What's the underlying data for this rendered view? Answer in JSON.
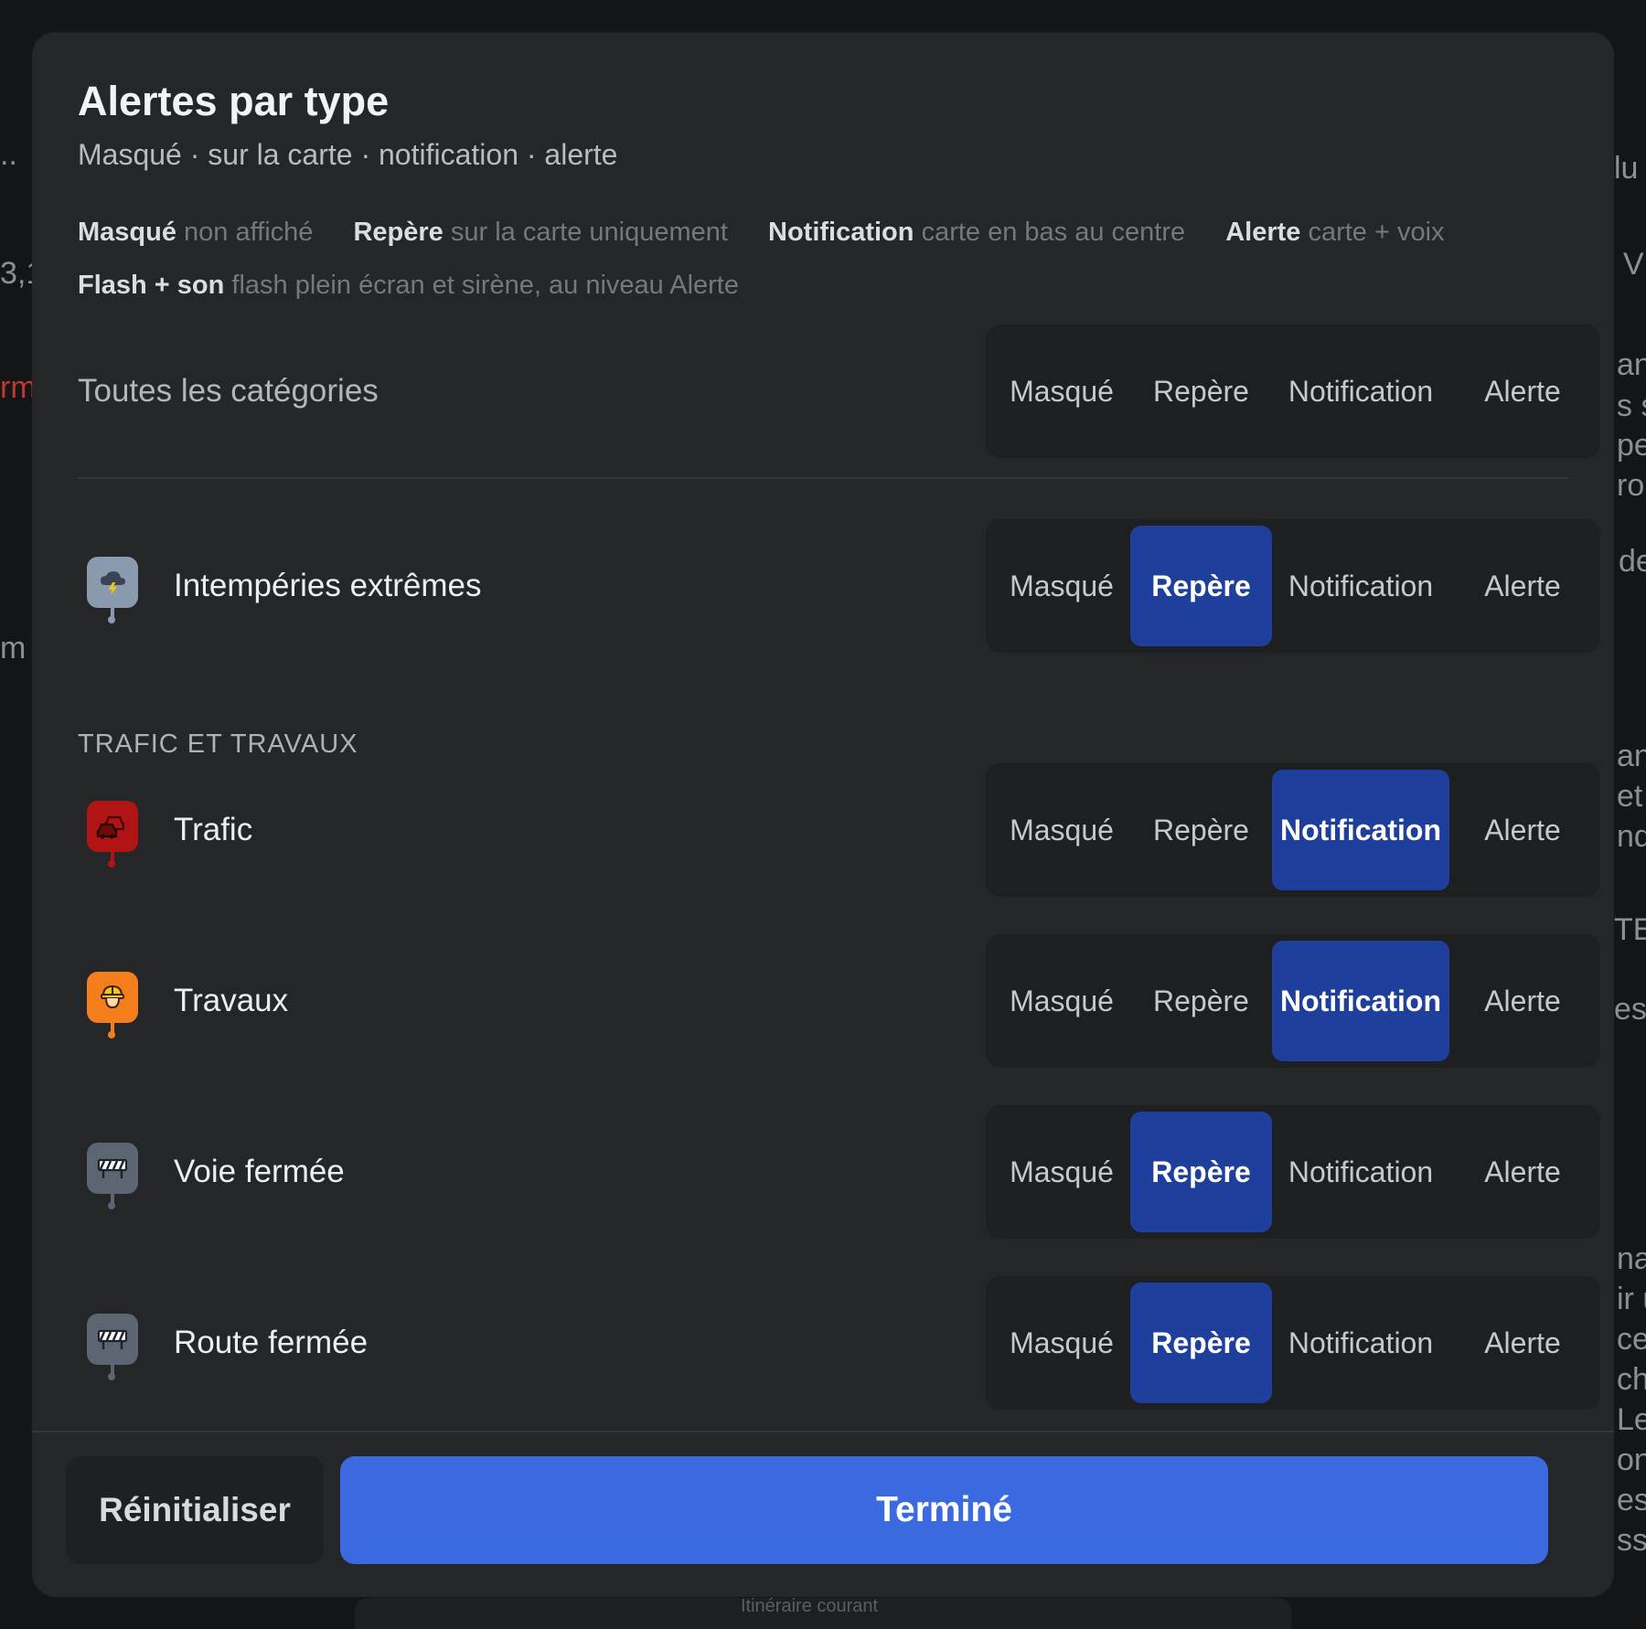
{
  "colors": {
    "modal_bg": "#252627",
    "segment_bg": "#1e1f20",
    "segment_active": "#1f3f9c",
    "primary_button": "#3b6ae0",
    "weather_icon": "#8a9bb0",
    "traffic_icon": "#b01414",
    "works_icon": "#f47d1c",
    "closure_icon": "#5c6673"
  },
  "background": {
    "fragments": [
      "..",
      "3,1",
      "rm",
      "m",
      "lu",
      "V",
      "an",
      "s s",
      "pe",
      "ron",
      "de",
      "an",
      "et",
      "nd",
      "TES",
      "es",
      "nac",
      "ir u",
      "ce",
      "che",
      "Le",
      "ons",
      "es l",
      "sse",
      "Itinéraire courant"
    ]
  },
  "dialog": {
    "title": "Alertes par type",
    "subtitle": "Masqué · sur la carte · notification · alerte",
    "legend": [
      {
        "term": "Masqué",
        "desc": "non affiché"
      },
      {
        "term": "Repère",
        "desc": "sur la carte uniquement"
      },
      {
        "term": "Notification",
        "desc": "carte en bas au centre"
      },
      {
        "term": "Alerte",
        "desc": "carte + voix"
      },
      {
        "term": "Flash + son",
        "desc": "flash plein écran et sirène, au niveau Alerte"
      }
    ],
    "options": [
      "Masqué",
      "Repère",
      "Notification",
      "Alerte"
    ],
    "all_categories": {
      "label": "Toutes les catégories",
      "selected": null
    },
    "weather_row": {
      "label": "Intempéries extrêmes",
      "icon": "storm-icon",
      "selected": "Repère"
    },
    "section_title": "TRAFIC ET TRAVAUX",
    "traffic_rows": [
      {
        "label": "Trafic",
        "icon": "traffic-car-icon",
        "selected": "Notification"
      },
      {
        "label": "Travaux",
        "icon": "worker-helmet-icon",
        "selected": "Notification"
      },
      {
        "label": "Voie fermée",
        "icon": "barrier-icon",
        "selected": "Repère"
      },
      {
        "label": "Route fermée",
        "icon": "barrier-icon",
        "selected": "Repère"
      }
    ],
    "reset_label": "Réinitialiser",
    "done_label": "Terminé"
  }
}
